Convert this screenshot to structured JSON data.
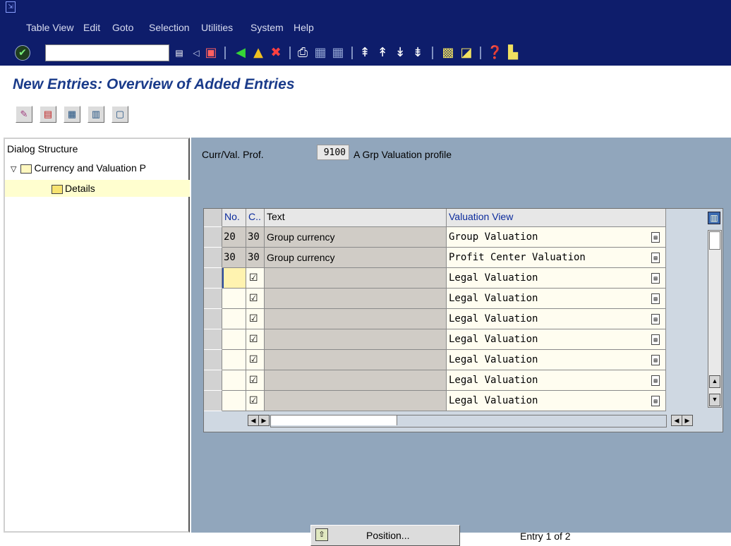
{
  "menu": {
    "items": [
      "Table View",
      "Edit",
      "Goto",
      "Selection",
      "Utilities",
      "System",
      "Help"
    ],
    "mnemonics": [
      "T",
      "E",
      "G",
      "l",
      "",
      "y",
      "H"
    ]
  },
  "toolbar": {
    "command_field_value": "",
    "icons": [
      "enter-icon",
      "history-icon",
      "back-arrow-icon",
      "save-icon",
      "back-icon",
      "exit-icon",
      "cancel-icon",
      "print-icon",
      "find-icon",
      "find-next-icon",
      "first-page-icon",
      "previous-page-icon",
      "next-page-icon",
      "last-page-icon",
      "create-session-icon",
      "shortcut-icon",
      "help-icon",
      "layout-icon"
    ]
  },
  "page": {
    "title": "New Entries: Overview of Added Entries"
  },
  "app_toolbar": {
    "icons": [
      "change-display-icon",
      "delete-icon",
      "select-all-icon",
      "select-block-icon",
      "deselect-all-icon"
    ]
  },
  "dialog_structure": {
    "header": "Dialog Structure",
    "items": [
      {
        "label": "Currency and Valuation P",
        "expanded": true,
        "level": 0
      },
      {
        "label": "Details",
        "expanded": false,
        "level": 1,
        "selected": true
      }
    ]
  },
  "profile": {
    "label": "Curr/Val. Prof.",
    "value": "9100",
    "description": "A Grp Valuation profile"
  },
  "table": {
    "columns": [
      "No.",
      "C..",
      "Text",
      "Valuation View"
    ],
    "rows": [
      {
        "no": "20",
        "c": "30",
        "text": "Group currency",
        "view": "Group Valuation",
        "checked": false
      },
      {
        "no": "30",
        "c": "30",
        "text": "Group currency",
        "view": "Profit Center Valuation",
        "checked": false
      },
      {
        "no": "",
        "c": "",
        "text": "",
        "view": "Legal Valuation",
        "checked": true
      },
      {
        "no": "",
        "c": "",
        "text": "",
        "view": "Legal Valuation",
        "checked": true
      },
      {
        "no": "",
        "c": "",
        "text": "",
        "view": "Legal Valuation",
        "checked": true
      },
      {
        "no": "",
        "c": "",
        "text": "",
        "view": "Legal Valuation",
        "checked": true
      },
      {
        "no": "",
        "c": "",
        "text": "",
        "view": "Legal Valuation",
        "checked": true
      },
      {
        "no": "",
        "c": "",
        "text": "",
        "view": "Legal Valuation",
        "checked": true
      },
      {
        "no": "",
        "c": "",
        "text": "",
        "view": "Legal Valuation",
        "checked": true
      }
    ]
  },
  "footer": {
    "position_button": "Position...",
    "entry_status": "Entry 1 of 2"
  },
  "colors": {
    "menubar": "#0e1d6b",
    "title": "#1a3b8a",
    "panel_bg": "#91a6bc",
    "selected_tree_row": "#fffecf",
    "header_blue_text": "#0a2a9c"
  }
}
